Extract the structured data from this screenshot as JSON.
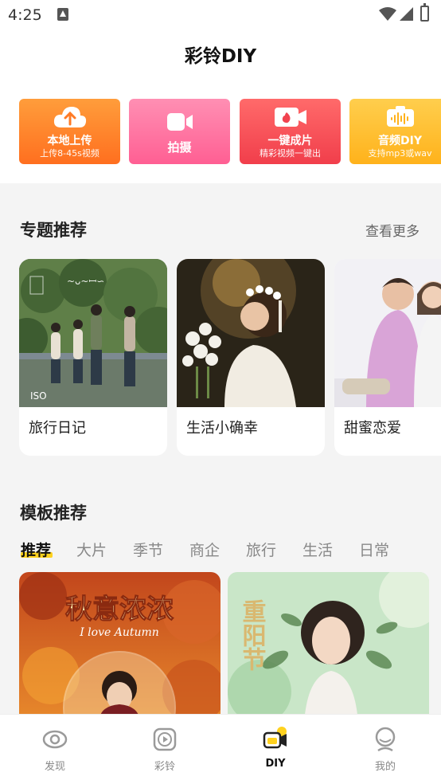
{
  "status_bar": {
    "time": "4:25"
  },
  "header": {
    "title": "彩铃DIY"
  },
  "actions": [
    {
      "label": "本地上传",
      "sub": "上传8-45s视频",
      "icon": "cloud-upload-icon"
    },
    {
      "label": "拍摄",
      "sub": "",
      "icon": "video-camera-icon"
    },
    {
      "label": "一键成片",
      "sub": "精彩视频一键出",
      "icon": "flame-video-icon"
    },
    {
      "label": "音频DIY",
      "sub": "支持mp3或wav",
      "icon": "audio-wave-icon"
    }
  ],
  "topics": {
    "title": "专题推荐",
    "more": "查看更多",
    "cards": [
      {
        "caption": "旅行日记",
        "overlay_text": "ISO"
      },
      {
        "caption": "生活小确幸"
      },
      {
        "caption": "甜蜜恋爱"
      }
    ]
  },
  "templates": {
    "title": "模板推荐",
    "tabs": [
      "推荐",
      "大片",
      "季节",
      "商企",
      "旅行",
      "生活",
      "日常"
    ],
    "active_tab": 0,
    "cards": [
      {
        "title": "秋意浓浓",
        "subtitle": "I love Autumn"
      },
      {
        "title": "重阳节"
      }
    ]
  },
  "bottom_nav": [
    {
      "label": "发现",
      "icon": "eye-icon"
    },
    {
      "label": "彩铃",
      "icon": "play-box-icon"
    },
    {
      "label": "DIY",
      "icon": "video-diy-icon"
    },
    {
      "label": "我的",
      "icon": "profile-icon"
    }
  ],
  "colors": {
    "accent": "#ffd21f",
    "text": "#222222",
    "muted": "#888888"
  }
}
